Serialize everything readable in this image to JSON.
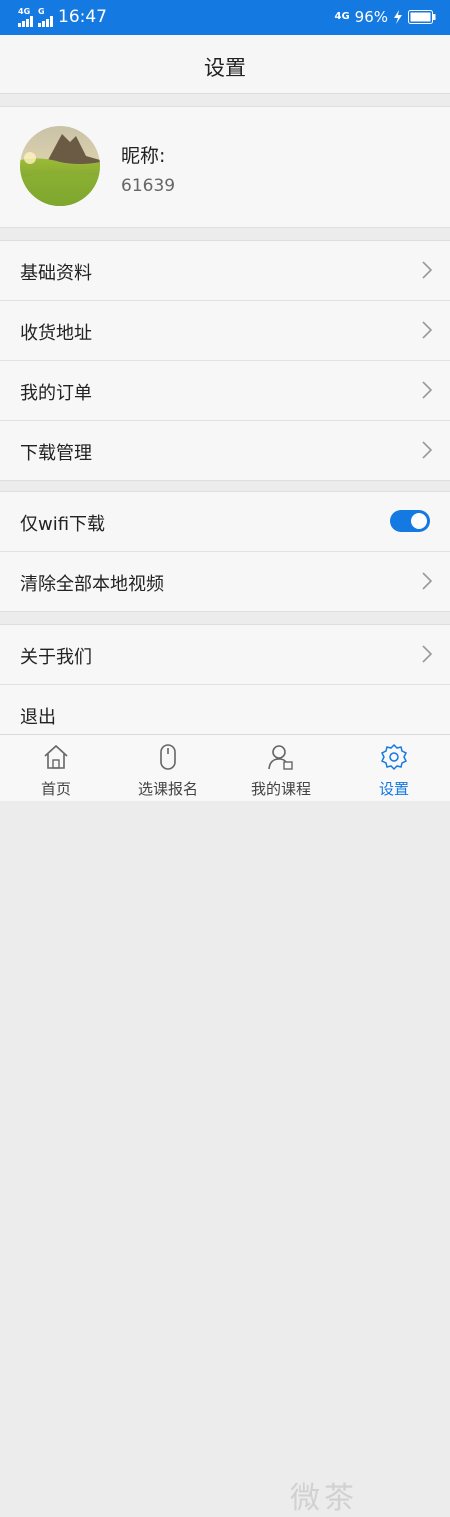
{
  "status_bar": {
    "signal_left_1": "4G",
    "signal_left_2": "G",
    "time": "16:47",
    "signal_right": "4G",
    "battery_percent": "96%"
  },
  "header": {
    "title": "设置"
  },
  "profile": {
    "nickname_label": "昵称:",
    "nickname_value": "61639"
  },
  "menu_group_1": [
    {
      "label": "基础资料"
    },
    {
      "label": "收货地址"
    },
    {
      "label": "我的订单"
    },
    {
      "label": "下载管理"
    }
  ],
  "menu_group_2": {
    "wifi_only": {
      "label": "仅wifi下载",
      "enabled": true
    },
    "clear_videos": {
      "label": "清除全部本地视频"
    }
  },
  "menu_group_3": {
    "about": {
      "label": "关于我们"
    },
    "logout": {
      "label": "退出"
    }
  },
  "tabs": [
    {
      "label": "首页",
      "icon": "home-icon",
      "active": false
    },
    {
      "label": "选课报名",
      "icon": "mouse-icon",
      "active": false
    },
    {
      "label": "我的课程",
      "icon": "user-course-icon",
      "active": false
    },
    {
      "label": "设置",
      "icon": "gear-icon",
      "active": true
    }
  ],
  "colors": {
    "accent": "#1479e0",
    "background": "#ececec"
  },
  "watermark": {
    "text": "微茶"
  }
}
